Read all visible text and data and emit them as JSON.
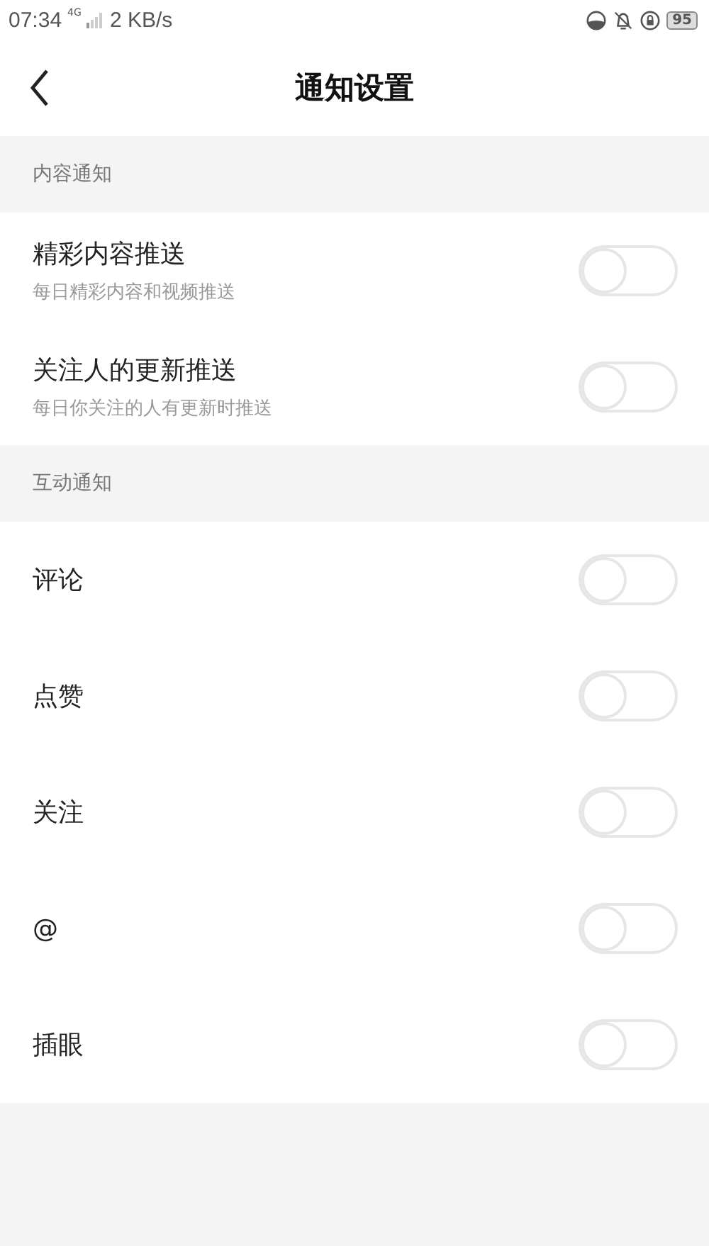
{
  "status_bar": {
    "time": "07:34",
    "network": "4G",
    "speed": "2 KB/s",
    "battery": "95"
  },
  "header": {
    "title": "通知设置"
  },
  "sections": [
    {
      "title": "内容通知",
      "items": [
        {
          "label": "精彩内容推送",
          "description": "每日精彩内容和视频推送",
          "on": false
        },
        {
          "label": "关注人的更新推送",
          "description": "每日你关注的人有更新时推送",
          "on": false
        }
      ]
    },
    {
      "title": "互动通知",
      "items": [
        {
          "label": "评论",
          "on": false
        },
        {
          "label": "点赞",
          "on": false
        },
        {
          "label": "关注",
          "on": false
        },
        {
          "label": "@",
          "on": false
        },
        {
          "label": "插眼",
          "on": false
        }
      ]
    }
  ]
}
